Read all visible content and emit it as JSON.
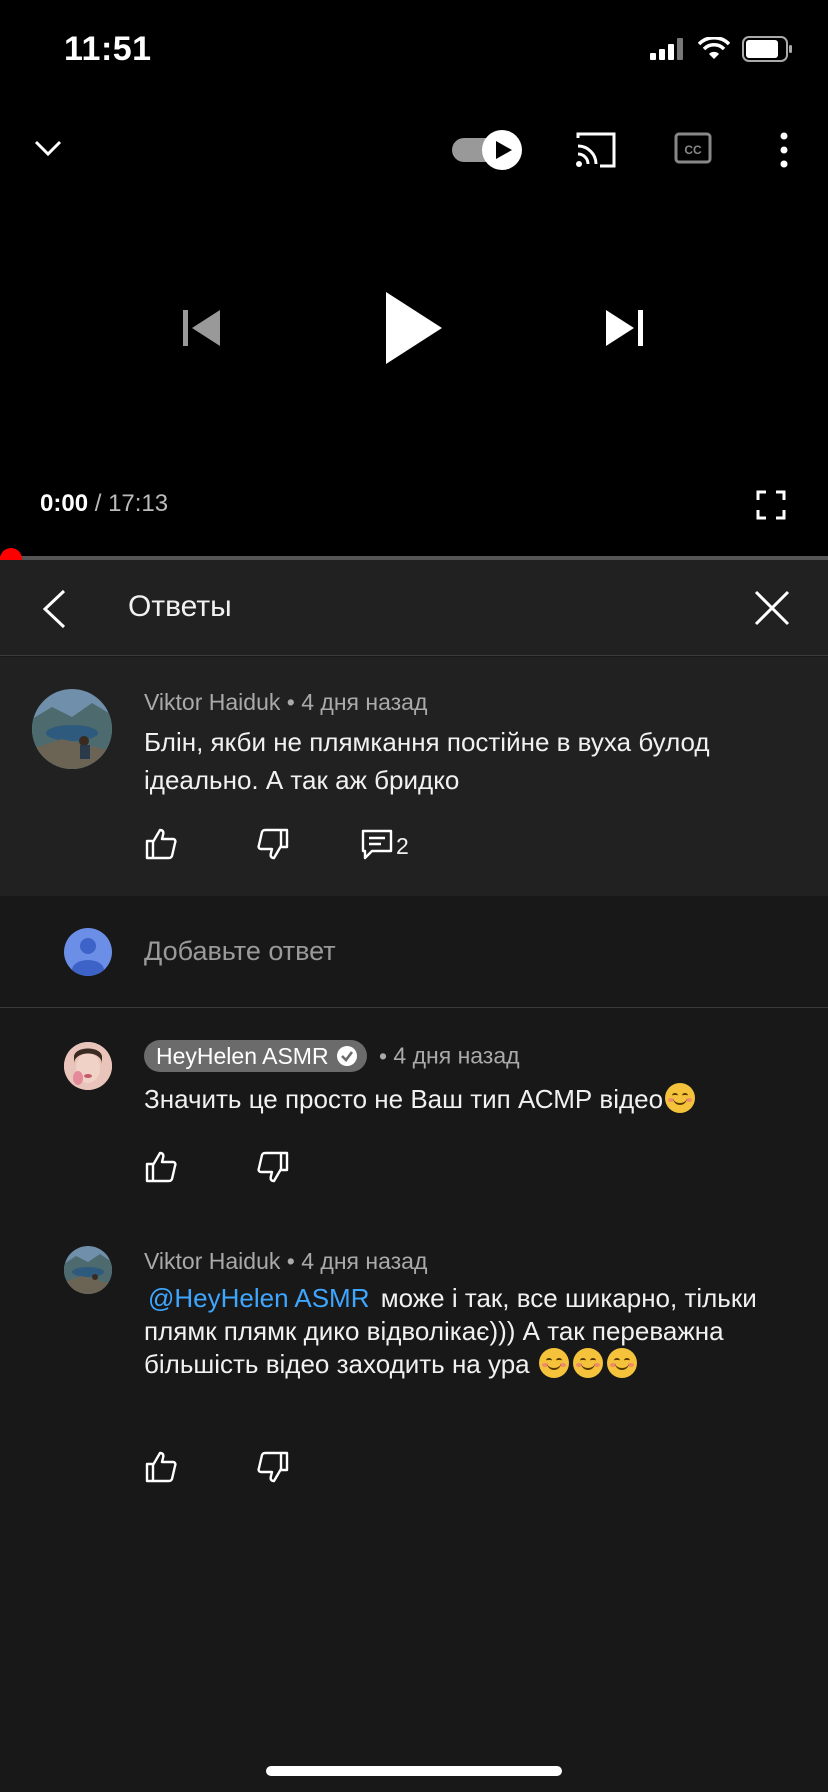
{
  "status_bar": {
    "time": "11:51"
  },
  "player": {
    "current_time": "0:00",
    "separator": " / ",
    "duration": "17:13",
    "progress": 0.0
  },
  "replies_panel": {
    "title": "Ответы"
  },
  "parent_comment": {
    "author": "Viktor Haiduk",
    "age": "4 дня назад",
    "text": "Блін, якби не плямкання постійне в вуха булод ідеально. А так аж бридко",
    "reply_count": "2"
  },
  "add_reply": {
    "placeholder": "Добавьте ответ"
  },
  "replies": [
    {
      "author": "HeyHelen ASMR",
      "age": "4 дня назад",
      "text": "Значить це просто не Ваш тип АСМР відео"
    },
    {
      "author": "Viktor Haiduk",
      "age": "4 дня назад",
      "mention": "@HeyHelen ASMR",
      "text": "може і так, все шикарно, тільки плямк плямк дико відволікає))) А так переважна більшість відео заходить на ура"
    }
  ],
  "meta_separator": "•",
  "colors": {
    "accent_red": "#ff0000",
    "mention_blue": "#3ea6ff"
  },
  "icons": [
    "chevron-down-icon",
    "autoplay-toggle",
    "cast-icon",
    "captions-icon",
    "more-icon",
    "previous-icon",
    "play-icon",
    "next-icon",
    "fullscreen-icon",
    "back-arrow-icon",
    "close-icon",
    "like-icon",
    "dislike-icon",
    "reply-icon",
    "verified-icon"
  ]
}
